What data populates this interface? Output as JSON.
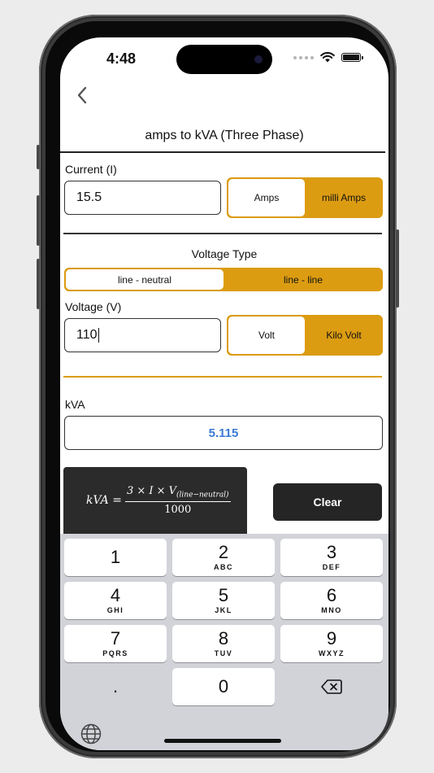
{
  "status": {
    "time": "4:48"
  },
  "nav": {
    "title": "amps to kVA (Three Phase)"
  },
  "current": {
    "label": "Current (I)",
    "value": "15.5",
    "units": [
      "Amps",
      "milli Amps"
    ],
    "selected_unit": "Amps"
  },
  "voltage_type": {
    "label": "Voltage Type",
    "options": [
      "line - neutral",
      "line - line"
    ],
    "selected": "line - neutral"
  },
  "voltage": {
    "label": "Voltage (V)",
    "value": "110",
    "units": [
      "Volt",
      "Kilo Volt"
    ],
    "selected_unit": "Volt"
  },
  "result": {
    "label": "kVA",
    "value": "5.115"
  },
  "formula": {
    "lhs": "kVA =",
    "numerator": "3 × I × V",
    "numerator_sub": "(line−neutral)",
    "denominator": "1000"
  },
  "actions": {
    "clear_label": "Clear"
  },
  "keyboard": {
    "keys": [
      {
        "digit": "1",
        "letters": ""
      },
      {
        "digit": "2",
        "letters": "ABC"
      },
      {
        "digit": "3",
        "letters": "DEF"
      },
      {
        "digit": "4",
        "letters": "GHI"
      },
      {
        "digit": "5",
        "letters": "JKL"
      },
      {
        "digit": "6",
        "letters": "MNO"
      },
      {
        "digit": "7",
        "letters": "PQRS"
      },
      {
        "digit": "8",
        "letters": "TUV"
      },
      {
        "digit": "9",
        "letters": "WXYZ"
      }
    ],
    "decimal": ".",
    "zero": "0",
    "delete_icon": "delete-backward-icon",
    "globe_icon": "globe-icon"
  },
  "colors": {
    "accent": "#dc9c12",
    "result_text": "#3a7bd5",
    "clear_bg": "#252525",
    "keyboard_bg": "#d1d3d9"
  }
}
